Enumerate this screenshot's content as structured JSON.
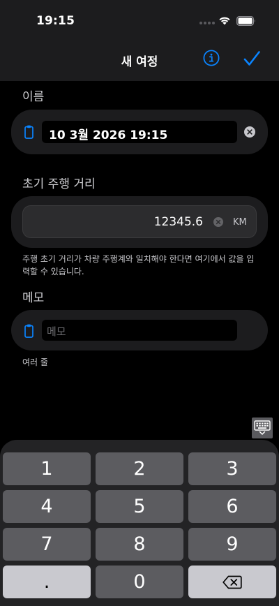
{
  "status_bar": {
    "time": "19:15"
  },
  "nav": {
    "title": "새 여정"
  },
  "name_section": {
    "label": "이름",
    "value": "10 3월 2026 19:15"
  },
  "odometer_section": {
    "label": "초기 주행 거리",
    "value": "12345.6",
    "unit": "KM",
    "helper": "주행 초기 거리가 차량 주행계와 일치해야 한다면 여기에서 값을 입력할 수 있습니다."
  },
  "memo_section": {
    "label": "메모",
    "placeholder": "메모",
    "helper": "여러 줄"
  },
  "keyboard": {
    "keys": [
      "1",
      "2",
      "3",
      "4",
      "5",
      "6",
      "7",
      "8",
      "9",
      ".",
      "0"
    ]
  },
  "colors": {
    "accent": "#0a84ff",
    "background": "#000000",
    "card": "#1c1c1e"
  }
}
